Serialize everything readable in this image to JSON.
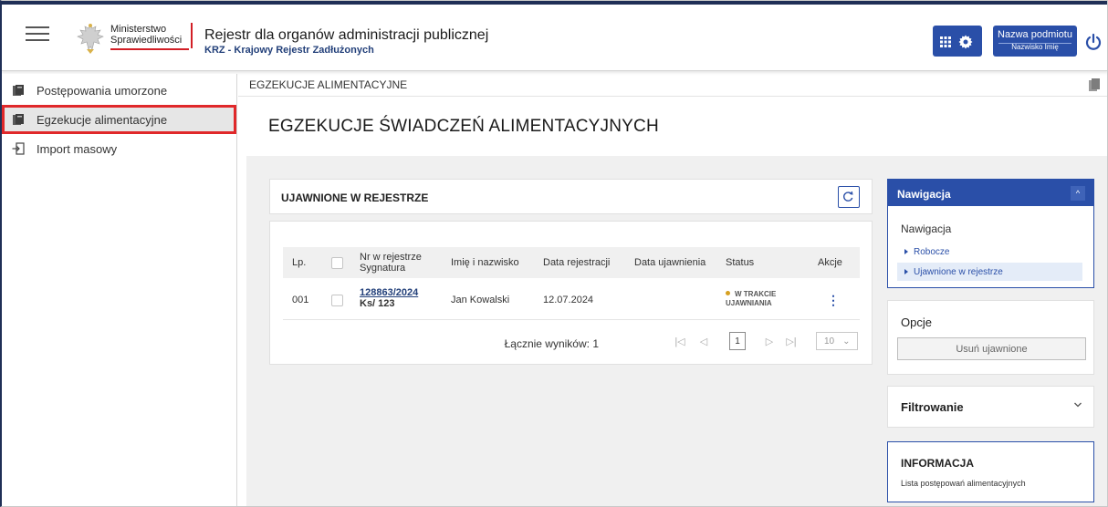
{
  "header": {
    "ministry_line1": "Ministerstwo",
    "ministry_line2": "Sprawiedliwości",
    "app_title": "Rejestr dla organów administracji publicznej",
    "app_subtitle": "KRZ - Krajowy Rejestr Zadłużonych",
    "entity_name": "Nazwa podmiotu",
    "person_name": "Nazwisko Imię",
    "icons": [
      "menu-icon",
      "ministry-eagle-logo",
      "grid-icon",
      "gear-icon",
      "power-icon"
    ]
  },
  "sidebar": {
    "items": [
      {
        "label": "Postępowania umorzone",
        "icon": "folder-icon",
        "active": false
      },
      {
        "label": "Egzekucje alimentacyjne",
        "icon": "folder-icon",
        "active": true
      },
      {
        "label": "Import masowy",
        "icon": "import-icon",
        "active": false
      }
    ]
  },
  "breadcrumb": "EGZEKUCJE ALIMENTACYJNE",
  "page_title": "EGZEKUCJE ŚWIADCZEŃ ALIMENTACYJNYCH",
  "table_panel": {
    "title": "UJAWNIONE W REJESTRZE",
    "columns": {
      "lp": "Lp.",
      "nr_line1": "Nr w rejestrze",
      "nr_line2": "Sygnatura",
      "name": "Imię i nazwisko",
      "reg_date": "Data rejestracji",
      "pub_date": "Data ujawnienia",
      "status": "Status",
      "actions": "Akcje"
    },
    "rows": [
      {
        "lp": "001",
        "nr": "128863/2024",
        "signature": "Ks/ 123",
        "name": "Jan Kowalski",
        "reg_date": "12.07.2024",
        "pub_date": "",
        "status_line1": "W TRAKCIE",
        "status_line2": "UJAWNIANIA"
      }
    ],
    "total_label": "Łącznie wyników: 1",
    "current_page": "1",
    "page_size": "10"
  },
  "nav_card": {
    "header": "Nawigacja",
    "subtitle": "Nawigacja",
    "links": [
      {
        "label": "Robocze",
        "selected": false
      },
      {
        "label": "Ujawnione w rejestrze",
        "selected": true
      }
    ]
  },
  "options_card": {
    "title": "Opcje",
    "button": "Usuń ujawnione"
  },
  "filter_card": {
    "title": "Filtrowanie"
  },
  "info_card": {
    "title": "INFORMACJA",
    "text": "Lista postępowań alimentacyjnych"
  },
  "colors": {
    "primary": "#2a4fa8",
    "highlight_border": "#e0282a",
    "status_dot": "#d6a021"
  }
}
